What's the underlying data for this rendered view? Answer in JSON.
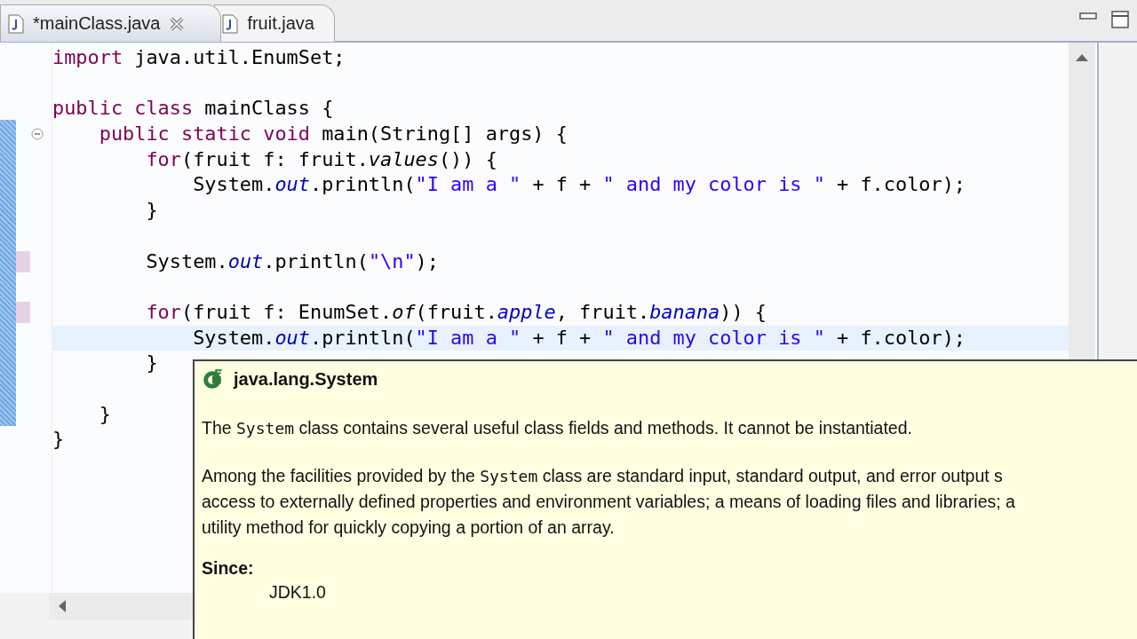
{
  "tabs": [
    {
      "label": "*mainClass.java",
      "selected": true,
      "closable": true
    },
    {
      "label": "fruit.java",
      "selected": false,
      "closable": false
    }
  ],
  "editor": {
    "lines": [
      {
        "current": false,
        "changed": false,
        "fold_marker": false,
        "tokens": [
          {
            "kind": "keyword",
            "text": "import"
          },
          {
            "kind": "plain",
            "text": " java.util.EnumSet;"
          }
        ]
      },
      {
        "current": false,
        "changed": false,
        "fold_marker": false
      },
      {
        "current": false,
        "changed": false,
        "fold_marker": false,
        "tokens": [
          {
            "kind": "keyword",
            "text": "public class"
          },
          {
            "kind": "plain",
            "text": " mainClass {"
          }
        ]
      },
      {
        "current": false,
        "changed": false,
        "fold_marker": true,
        "tokens": [
          {
            "kind": "keyword",
            "text": "    public static void"
          },
          {
            "kind": "plain",
            "text": " main(String[] args) {"
          }
        ]
      },
      {
        "current": false,
        "changed": false,
        "fold_marker": false,
        "tokens": [
          {
            "kind": "keyword",
            "text": "        for"
          },
          {
            "kind": "plain",
            "text": "(fruit f: fruit."
          },
          {
            "kind": "static",
            "text": "values"
          },
          {
            "kind": "plain",
            "text": "()) {"
          }
        ]
      },
      {
        "current": false,
        "changed": false,
        "fold_marker": false,
        "tokens": [
          {
            "kind": "plain",
            "text": "            System."
          },
          {
            "kind": "field",
            "text": "out"
          },
          {
            "kind": "plain",
            "text": ".println("
          },
          {
            "kind": "string",
            "text": "\"I am a \""
          },
          {
            "kind": "plain",
            "text": " + f + "
          },
          {
            "kind": "string",
            "text": "\" and my color is \""
          },
          {
            "kind": "plain",
            "text": " + f.color);"
          }
        ]
      },
      {
        "current": false,
        "changed": false,
        "fold_marker": false,
        "tokens": [
          {
            "kind": "plain",
            "text": "        }"
          }
        ]
      },
      {
        "current": false,
        "changed": false,
        "fold_marker": false
      },
      {
        "current": false,
        "changed": true,
        "fold_marker": false,
        "tokens": [
          {
            "kind": "plain",
            "text": "        System."
          },
          {
            "kind": "field",
            "text": "out"
          },
          {
            "kind": "plain",
            "text": ".println("
          },
          {
            "kind": "string",
            "text": "\"\\n\""
          },
          {
            "kind": "plain",
            "text": ");"
          }
        ]
      },
      {
        "current": false,
        "changed": false,
        "fold_marker": false
      },
      {
        "current": false,
        "changed": true,
        "fold_marker": false,
        "tokens": [
          {
            "kind": "keyword",
            "text": "        for"
          },
          {
            "kind": "plain",
            "text": "(fruit f: EnumSet."
          },
          {
            "kind": "static",
            "text": "of"
          },
          {
            "kind": "plain",
            "text": "(fruit."
          },
          {
            "kind": "field",
            "text": "apple"
          },
          {
            "kind": "plain",
            "text": ", fruit."
          },
          {
            "kind": "field",
            "text": "banana"
          },
          {
            "kind": "plain",
            "text": ")) {"
          }
        ]
      },
      {
        "current": true,
        "changed": false,
        "fold_marker": false,
        "tokens": [
          {
            "kind": "plain",
            "text": "            System."
          },
          {
            "kind": "field",
            "text": "out"
          },
          {
            "kind": "plain",
            "text": ".println("
          },
          {
            "kind": "string",
            "text": "\"I am a \""
          },
          {
            "kind": "plain",
            "text": " + f + "
          },
          {
            "kind": "string",
            "text": "\" and my color is \""
          },
          {
            "kind": "plain",
            "text": " + f.color);"
          }
        ]
      },
      {
        "current": false,
        "changed": false,
        "fold_marker": false,
        "tokens": [
          {
            "kind": "plain",
            "text": "        }"
          }
        ]
      },
      {
        "current": false,
        "changed": false,
        "fold_marker": false
      },
      {
        "current": false,
        "changed": false,
        "fold_marker": false,
        "tokens": [
          {
            "kind": "plain",
            "text": "    }"
          }
        ]
      },
      {
        "current": false,
        "changed": false,
        "fold_marker": false,
        "tokens": [
          {
            "kind": "plain",
            "text": "}"
          }
        ]
      }
    ]
  },
  "tooltip": {
    "title": "java.lang.System",
    "paragraphs": [
      {
        "lines": [
          [
            {
              "kind": "text",
              "text": "The "
            },
            {
              "kind": "code",
              "text": "System"
            },
            {
              "kind": "text",
              "text": " class contains several useful class fields and methods. It cannot be instantiated."
            }
          ]
        ]
      },
      {
        "lines": [
          [
            {
              "kind": "text",
              "text": "Among the facilities provided by the "
            },
            {
              "kind": "code",
              "text": "System"
            },
            {
              "kind": "text",
              "text": " class are standard input, standard output, and error output s"
            }
          ],
          [
            {
              "kind": "text",
              "text": "access to externally defined properties and environment variables; a means of loading files and libraries; a"
            }
          ],
          [
            {
              "kind": "text",
              "text": "utility method for quickly copying a portion of an array."
            }
          ]
        ]
      }
    ],
    "since_label": "Since:",
    "since_value": "JDK1.0"
  }
}
